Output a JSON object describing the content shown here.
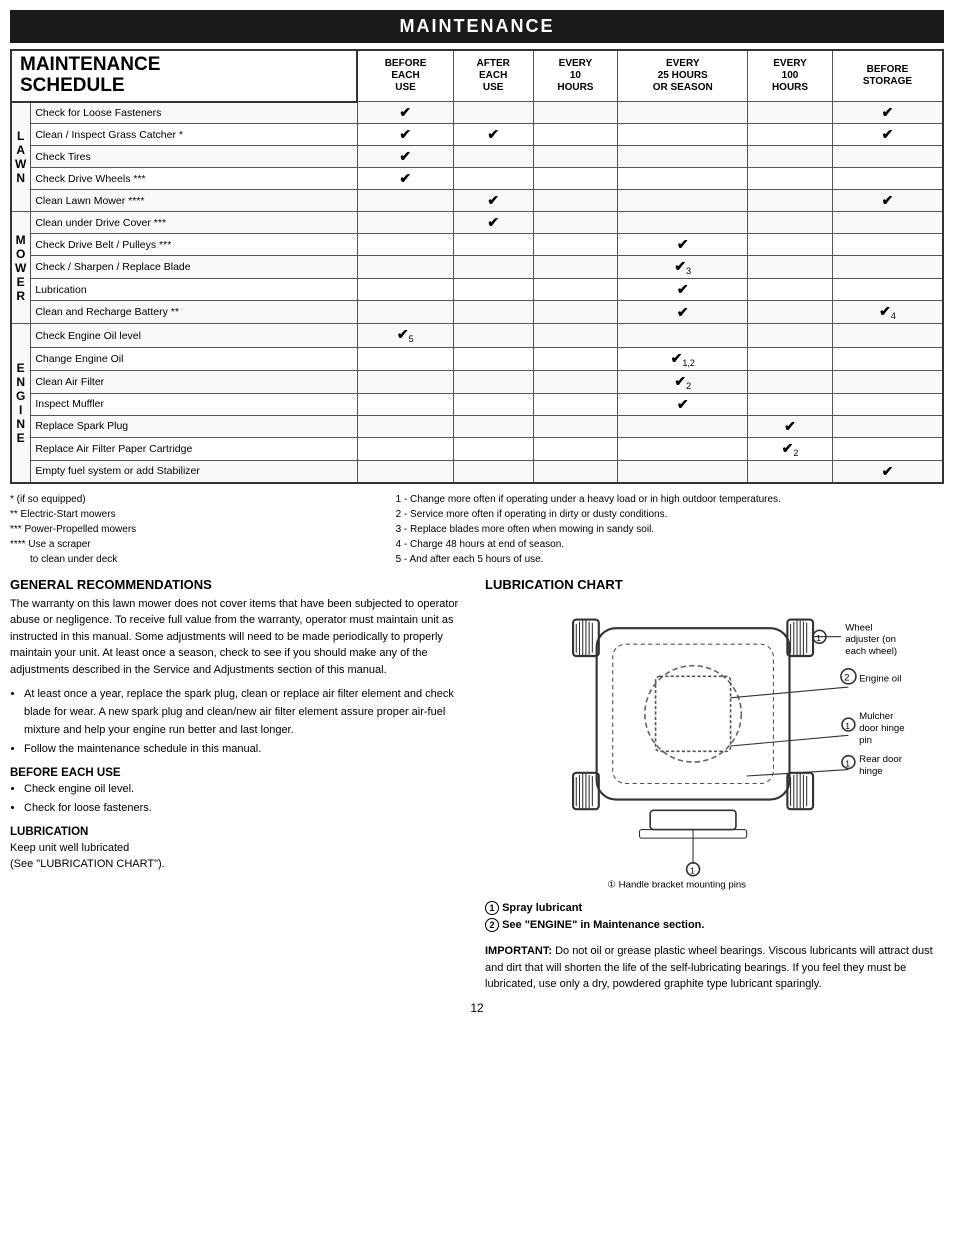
{
  "page": {
    "main_title": "MAINTENANCE",
    "schedule": {
      "title_line1": "MAINTENANCE",
      "title_line2": "SCHEDULE",
      "col_headers": [
        "BEFORE\nEACH\nUSE",
        "AFTER\nEACH\nUSE",
        "EVERY\n10\nHOURS",
        "EVERY\n25 HOURS\nOR SEASON",
        "EVERY\n100\nHOURS",
        "BEFORE\nSTORAGE"
      ],
      "sections": [
        {
          "label": "L\nA\nW\nN",
          "rows": [
            {
              "task": "Check for Loose Fasteners",
              "checks": [
                1,
                0,
                0,
                0,
                0,
                1
              ]
            },
            {
              "task": "Clean / Inspect Grass Catcher *",
              "checks": [
                1,
                1,
                0,
                0,
                0,
                1
              ]
            },
            {
              "task": "Check Tires",
              "checks": [
                1,
                0,
                0,
                0,
                0,
                0
              ]
            },
            {
              "task": "Check Drive Wheels ***",
              "checks": [
                1,
                0,
                0,
                0,
                0,
                0
              ]
            },
            {
              "task": "Clean Lawn Mower ****",
              "checks": [
                0,
                1,
                0,
                0,
                0,
                1
              ]
            }
          ]
        },
        {
          "label": "M\nO\nW\nE\nR",
          "rows": [
            {
              "task": "Clean under Drive Cover ***",
              "checks": [
                0,
                1,
                0,
                0,
                0,
                0
              ]
            },
            {
              "task": "Check Drive Belt / Pulleys ***",
              "checks": [
                0,
                0,
                0,
                1,
                0,
                0
              ]
            },
            {
              "task": "Check / Sharpen / Replace Blade",
              "checks": [
                0,
                0,
                0,
                "3",
                0,
                0
              ]
            },
            {
              "task": "Lubrication",
              "checks": [
                0,
                0,
                0,
                1,
                0,
                0
              ]
            },
            {
              "task": "Clean and Recharge Battery **",
              "checks": [
                0,
                0,
                0,
                1,
                0,
                "4"
              ]
            }
          ]
        },
        {
          "label": "E\nN\nG\nI\nN\nE",
          "rows": [
            {
              "task": "Check Engine Oil level",
              "checks": [
                "5",
                0,
                0,
                0,
                0,
                0
              ]
            },
            {
              "task": "Change Engine Oil",
              "checks": [
                0,
                0,
                0,
                "1,2",
                0,
                0
              ]
            },
            {
              "task": "Clean Air Filter",
              "checks": [
                0,
                0,
                0,
                "2",
                0,
                0
              ]
            },
            {
              "task": "Inspect Muffler",
              "checks": [
                0,
                0,
                0,
                1,
                0,
                0
              ]
            },
            {
              "task": "Replace Spark Plug",
              "checks": [
                0,
                0,
                0,
                0,
                1,
                0
              ]
            },
            {
              "task": "Replace Air Filter Paper Cartridge",
              "checks": [
                0,
                0,
                0,
                0,
                "2",
                0
              ]
            },
            {
              "task": "Empty fuel system or add Stabilizer",
              "checks": [
                0,
                0,
                0,
                0,
                0,
                1
              ]
            }
          ]
        }
      ]
    },
    "footnotes": {
      "left": [
        "* (if so equipped)",
        "** Electric-Start mowers",
        "*** Power-Propelled mowers",
        "**** Use a scraper",
        "     to clean under deck"
      ],
      "right": [
        "1 - Change more often if operating under a heavy load or in high outdoor temperatures.",
        "2 - Service more often if operating in dirty or dusty conditions.",
        "3 - Replace blades more often when mowing in sandy soil.",
        "4 - Charge 48 hours at end of season.",
        "5 - And after each 5 hours of use."
      ]
    },
    "general_rec": {
      "title": "GENERAL RECOMMENDATIONS",
      "body": "The warranty on this lawn mower does not cover items that have been subjected to operator abuse or negligence. To receive full value from the warranty, operator must maintain unit as instructed in this manual. Some adjustments will need to be made periodically to properly maintain your unit. At least once a season, check to see if you should make any of the adjustments described in the Service and Adjustments section of this manual.",
      "bullets": [
        "At least once a year, replace the spark plug, clean or replace air filter element and check blade for wear. A new spark plug and clean/new air filter element assure proper air-fuel mixture and help your engine run better and last longer.",
        "Follow the maintenance schedule in this manual."
      ],
      "before_each_use_title": "BEFORE EACH USE",
      "before_each_use_bullets": [
        "Check engine oil level.",
        "Check for loose fasteners."
      ],
      "lubrication_title": "LUBRICATION",
      "lubrication_body": "Keep unit well lubricated\n(See \"LUBRICATION CHART\")."
    },
    "lub_chart": {
      "title": "LUBRICATION CHART",
      "legend": [
        "① Spray lubricant",
        "② See \"ENGINE\" in Maintenance section."
      ],
      "labels": [
        {
          "num": "①",
          "text": "Wheel adjuster (on each wheel)"
        },
        {
          "num": "②",
          "text": "Engine oil"
        },
        {
          "num": "①",
          "text": "Mulcher door hinge pin"
        },
        {
          "num": "①",
          "text": "Rear door hinge"
        },
        {
          "num": "①",
          "text": "Handle bracket mounting pins"
        }
      ]
    },
    "important": {
      "label": "IMPORTANT:",
      "body": " Do not oil or grease plastic wheel bearings. Viscous lubricants will attract dust and dirt that will shorten the life of the self-lubricating bearings. If you feel they must be lubricated, use only a dry, powdered graphite type lubricant sparingly."
    },
    "page_number": "12"
  }
}
